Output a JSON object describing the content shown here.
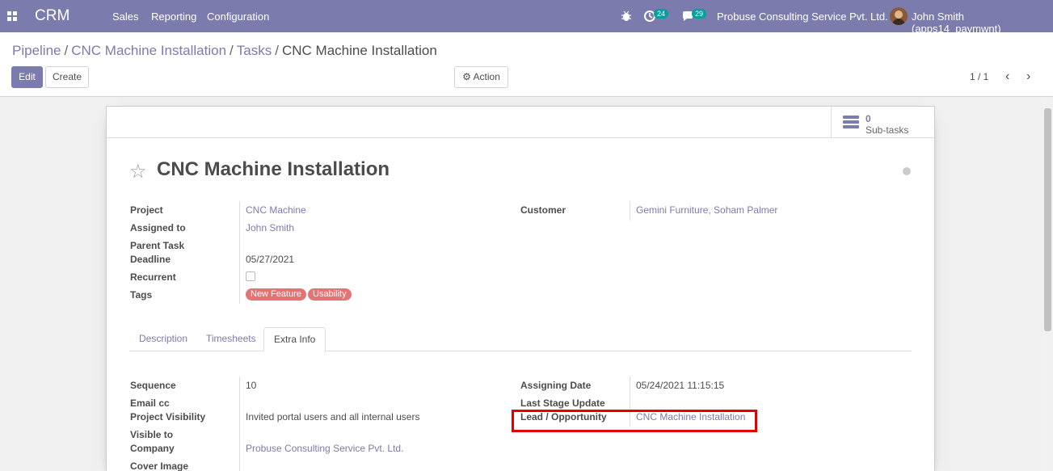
{
  "navbar": {
    "app_name": "CRM",
    "menu": [
      "Sales",
      "Reporting",
      "Configuration"
    ],
    "activity_count": "24",
    "message_count": "29",
    "company": "Probuse Consulting Service Pvt. Ltd.",
    "user": "John Smith (apps14_paymwnt)"
  },
  "breadcrumb": {
    "items": [
      "Pipeline",
      "CNC Machine Installation",
      "Tasks"
    ],
    "current": "CNC Machine Installation"
  },
  "toolbar": {
    "edit_label": "Edit",
    "create_label": "Create",
    "action_label": "Action",
    "pager": "1 / 1"
  },
  "stat": {
    "value": "0",
    "label": "Sub-tasks"
  },
  "record": {
    "title": "CNC Machine Installation",
    "left_fields": {
      "project_label": "Project",
      "project": "CNC Machine",
      "assigned_label": "Assigned to",
      "assigned": "John Smith",
      "parent_label": "Parent Task",
      "deadline_label": "Deadline",
      "deadline": "05/27/2021",
      "recurrent_label": "Recurrent",
      "tags_label": "Tags"
    },
    "tags": [
      "New Feature",
      "Usability"
    ],
    "right_fields": {
      "customer_label": "Customer",
      "customer": "Gemini Furniture, Soham Palmer"
    }
  },
  "tabs": [
    "Description",
    "Timesheets",
    "Extra Info"
  ],
  "extra_info": {
    "sequence_label": "Sequence",
    "sequence": "10",
    "email_cc_label": "Email cc",
    "visibility_label": "Project Visibility",
    "visibility": "Invited portal users and all internal users",
    "visible_to_label_1": "Visible to",
    "visible_to_label_2": "Company",
    "visible_to": "Probuse Consulting Service Pvt. Ltd.",
    "cover_image_label": "Cover Image",
    "assigning_date_label": "Assigning Date",
    "assigning_date": "05/24/2021 11:15:15",
    "last_stage_label": "Last Stage Update",
    "lead_label": "Lead / Opportunity",
    "lead": "CNC Machine Installation"
  },
  "colors": {
    "brand": "#7c7bad",
    "highlight": "#e30000",
    "tag": "#e57373",
    "badge": "#00a09d"
  }
}
